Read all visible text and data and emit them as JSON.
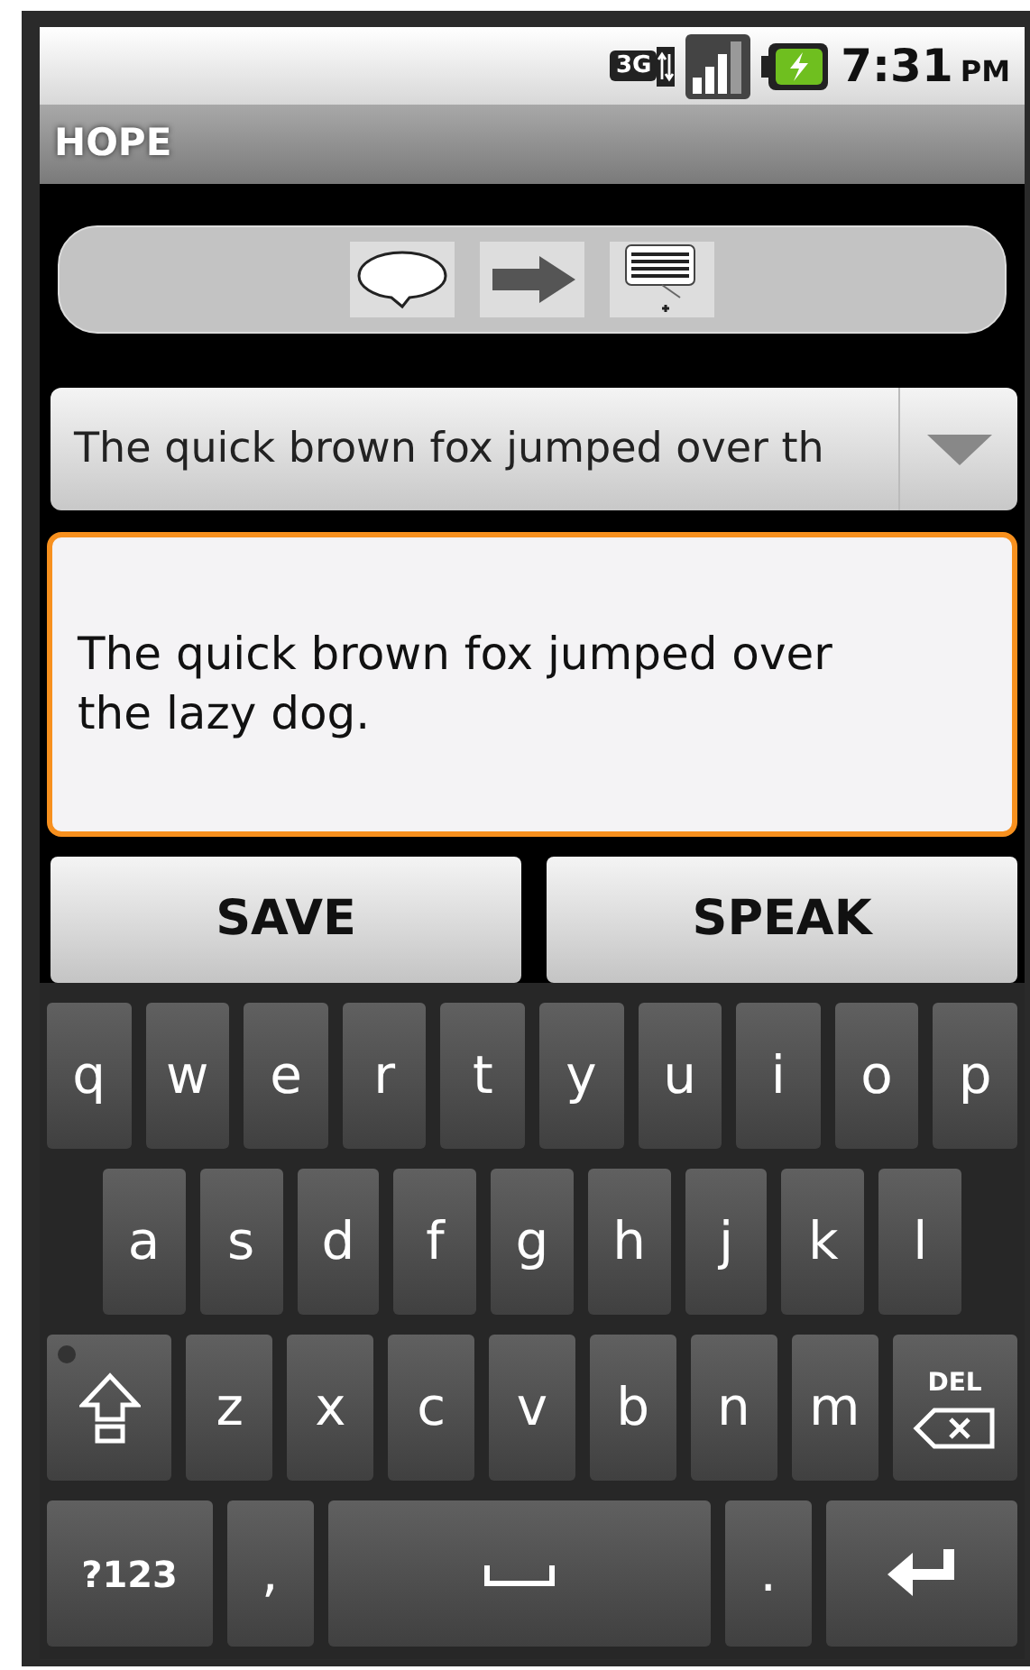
{
  "status_bar": {
    "network": "3G",
    "time": "7:31",
    "meridiem": "PM"
  },
  "app_title": "HOPE",
  "toolbar": [
    {
      "kind": "speech"
    },
    {
      "kind": "arrow"
    },
    {
      "kind": "note"
    }
  ],
  "phrase_spinner": {
    "value": "The quick brown fox jumped over th"
  },
  "message_field": {
    "value": "The quick brown fox jumped over the lazy dog.",
    "focused": true
  },
  "buttons": [
    "SAVE",
    "SPEAK"
  ],
  "keyboard": [
    [
      {
        "kind": "char",
        "label": "q"
      },
      {
        "kind": "char",
        "label": "w"
      },
      {
        "kind": "char",
        "label": "e"
      },
      {
        "kind": "char",
        "label": "r"
      },
      {
        "kind": "char",
        "label": "t"
      },
      {
        "kind": "char",
        "label": "y"
      },
      {
        "kind": "char",
        "label": "u"
      },
      {
        "kind": "char",
        "label": "i"
      },
      {
        "kind": "char",
        "label": "o"
      },
      {
        "kind": "char",
        "label": "p"
      }
    ],
    [
      {
        "kind": "char",
        "label": "a"
      },
      {
        "kind": "char",
        "label": "s"
      },
      {
        "kind": "char",
        "label": "d"
      },
      {
        "kind": "char",
        "label": "f"
      },
      {
        "kind": "char",
        "label": "g"
      },
      {
        "kind": "char",
        "label": "h"
      },
      {
        "kind": "char",
        "label": "j"
      },
      {
        "kind": "char",
        "label": "k"
      },
      {
        "kind": "char",
        "label": "l"
      }
    ],
    [
      {
        "kind": "shift"
      },
      {
        "kind": "char",
        "label": "z"
      },
      {
        "kind": "char",
        "label": "x"
      },
      {
        "kind": "char",
        "label": "c"
      },
      {
        "kind": "char",
        "label": "v"
      },
      {
        "kind": "char",
        "label": "b"
      },
      {
        "kind": "char",
        "label": "n"
      },
      {
        "kind": "char",
        "label": "m"
      },
      {
        "kind": "delete",
        "label": "DEL"
      }
    ],
    [
      {
        "kind": "symbols",
        "label": "?123"
      },
      {
        "kind": "char",
        "label": ","
      },
      {
        "kind": "space"
      },
      {
        "kind": "char",
        "label": "."
      },
      {
        "kind": "enter"
      }
    ]
  ]
}
